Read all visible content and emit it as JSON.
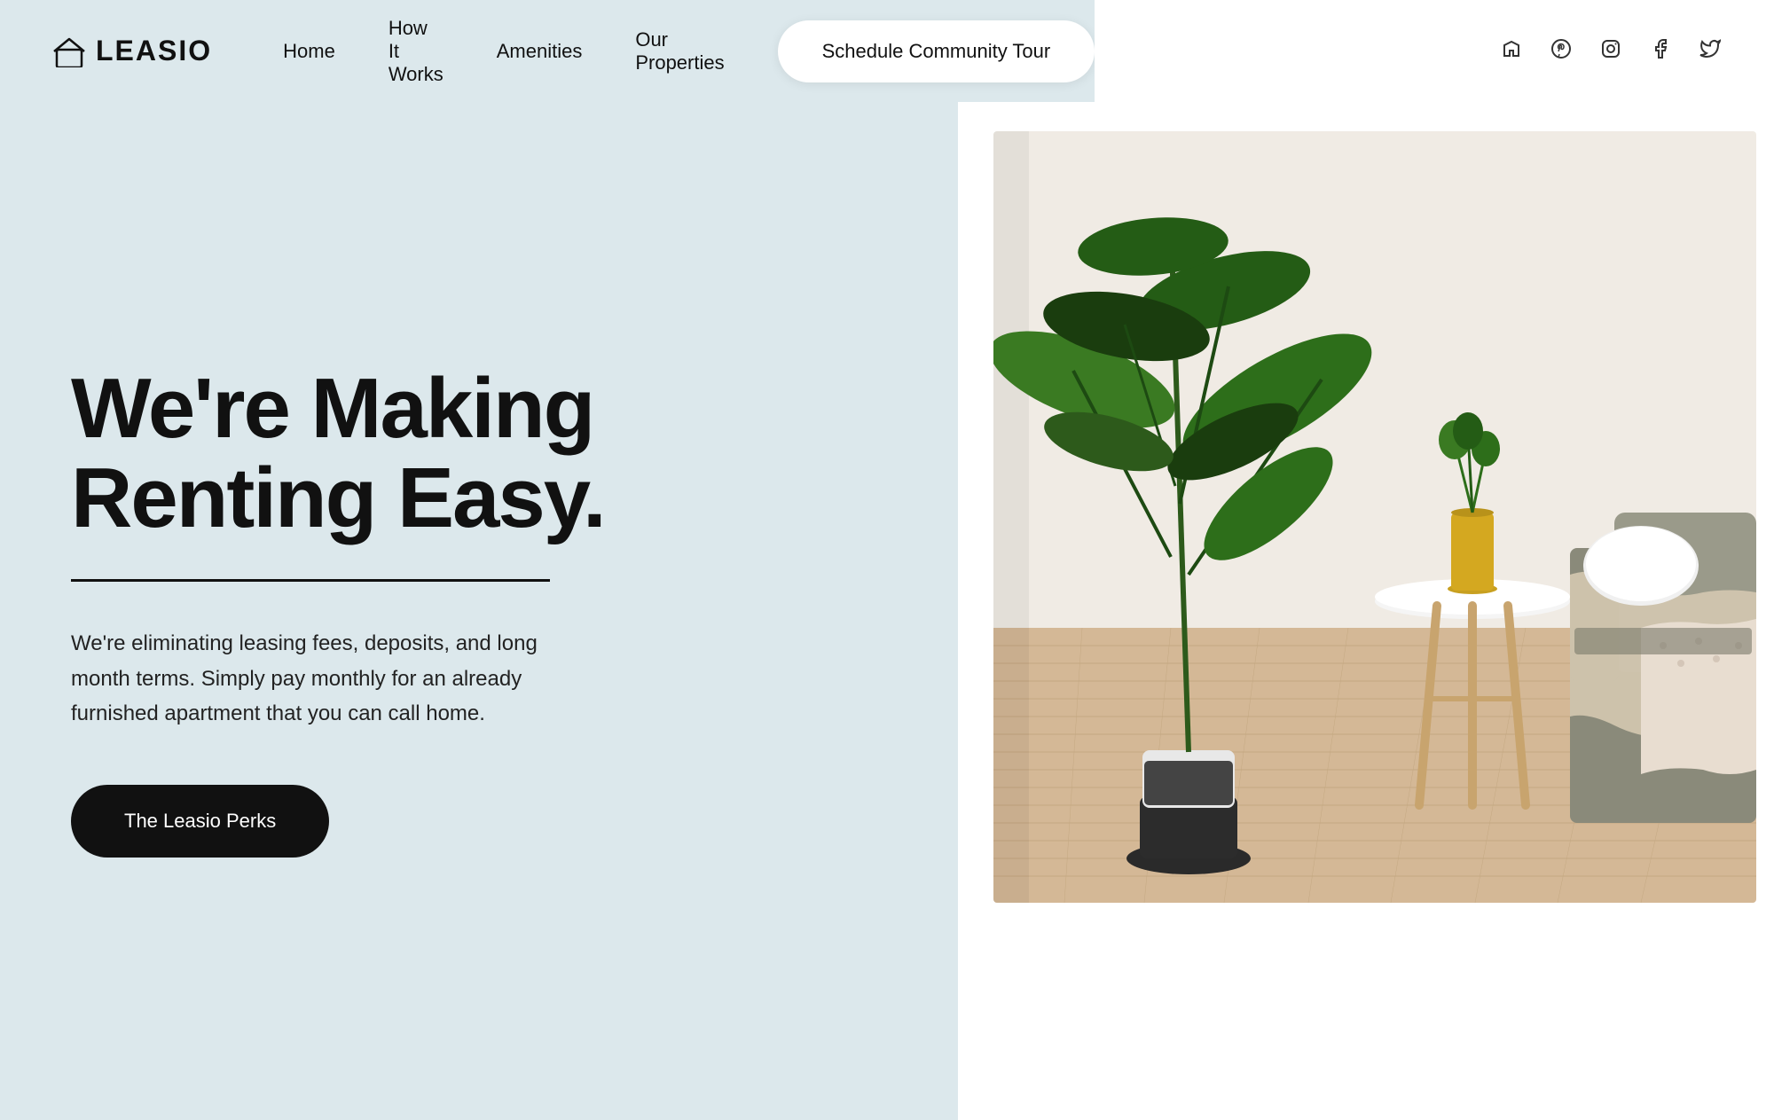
{
  "navbar": {
    "logo_text": "LEASIO",
    "nav_items": [
      {
        "label": "Home",
        "id": "home"
      },
      {
        "label": "How It Works",
        "id": "how-it-works"
      },
      {
        "label": "Amenities",
        "id": "amenities"
      },
      {
        "label": "Our Properties",
        "id": "our-properties"
      }
    ],
    "cta_button": "Schedule Community Tour",
    "social_icons": [
      {
        "name": "houzz-icon",
        "symbol": "⌂"
      },
      {
        "name": "pinterest-icon",
        "symbol": "𝒫"
      },
      {
        "name": "instagram-icon",
        "symbol": "◻"
      },
      {
        "name": "facebook-icon",
        "symbol": "f"
      },
      {
        "name": "twitter-icon",
        "symbol": "𝕏"
      }
    ]
  },
  "hero": {
    "title_line1": "We're Making",
    "title_line2": "Renting Easy.",
    "description": "We're eliminating leasing fees, deposits, and long month terms. Simply pay monthly for an already furnished apartment that you can call home.",
    "cta_button": "The Leasio Perks"
  },
  "colors": {
    "bg_left": "#dce8ec",
    "bg_right": "#ffffff",
    "text_dark": "#111111",
    "btn_dark_bg": "#111111",
    "btn_dark_text": "#ffffff",
    "btn_light_bg": "#ffffff",
    "divider": "#111111"
  }
}
